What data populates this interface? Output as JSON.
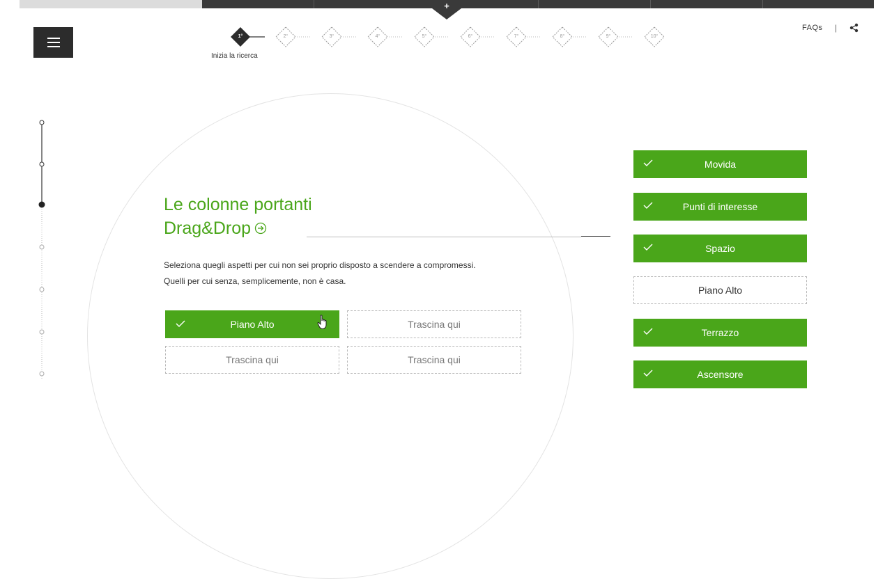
{
  "topbar": {
    "plus_label": "+"
  },
  "stepper": {
    "steps": [
      "1°",
      "2°",
      "3°",
      "4°",
      "5°",
      "6°",
      "7°",
      "8°",
      "9°",
      "10°"
    ],
    "current_caption": "Inizia la ricerca"
  },
  "header_links": {
    "faqs": "FAQs",
    "separator": "|"
  },
  "main": {
    "title_line1": "Le colonne portanti",
    "title_line2": "Drag&Drop",
    "description_line1": "Seleziona quegli aspetti per cui non sei proprio disposto a scendere a compromessi.",
    "description_line2": "Quelli per cui senza, semplicemente, non è casa.",
    "slots": [
      {
        "label": "Piano Alto",
        "filled": true
      },
      {
        "label": "Trascina qui",
        "filled": false
      },
      {
        "label": "Trascina qui",
        "filled": false
      },
      {
        "label": "Trascina qui",
        "filled": false
      }
    ]
  },
  "options": [
    {
      "label": "Movida",
      "selected": true
    },
    {
      "label": "Punti di interesse",
      "selected": true
    },
    {
      "label": "Spazio",
      "selected": true
    },
    {
      "label": "Piano Alto",
      "selected": false
    },
    {
      "label": "Terrazzo",
      "selected": true
    },
    {
      "label": "Ascensore",
      "selected": true
    }
  ],
  "colors": {
    "accent": "#4aa61a",
    "dark": "#2c2c2c"
  },
  "icons": {
    "menu": "hamburger-icon",
    "share": "share-icon",
    "check": "check-icon",
    "arrow": "circle-arrow-right-icon",
    "cursor": "hand-pointer-icon"
  }
}
